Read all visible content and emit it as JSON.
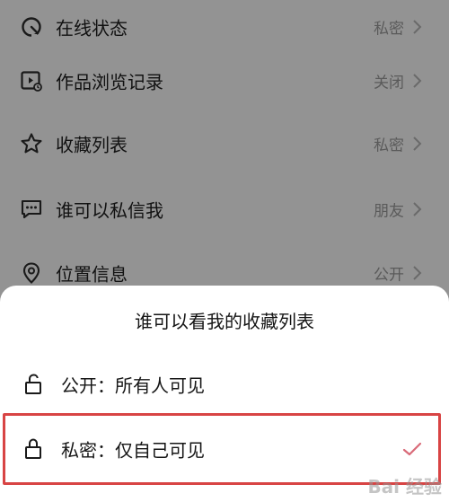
{
  "settings": {
    "items": [
      {
        "label": "在线状态",
        "value": "私密",
        "icon": "clock-circle-icon"
      },
      {
        "label": "作品浏览记录",
        "value": "关闭",
        "icon": "video-history-icon"
      },
      {
        "label": "收藏列表",
        "value": "私密",
        "icon": "star-icon"
      },
      {
        "label": "谁可以私信我",
        "value": "朋友",
        "icon": "message-icon"
      },
      {
        "label": "位置信息",
        "value": "公开",
        "icon": "location-pin-icon"
      }
    ]
  },
  "sheet": {
    "title": "谁可以看我的收藏列表",
    "options": [
      {
        "label": "公开：所有人可见",
        "icon": "unlock-icon",
        "selected": false
      },
      {
        "label": "私密：仅自己可见",
        "icon": "lock-icon",
        "selected": true
      }
    ]
  },
  "watermark": {
    "text": "Bai 经验"
  },
  "colors": {
    "overlay_background": "#939393",
    "sheet_background": "#ffffff",
    "highlight_border": "#d84444",
    "check_mark": "#d96a78"
  }
}
